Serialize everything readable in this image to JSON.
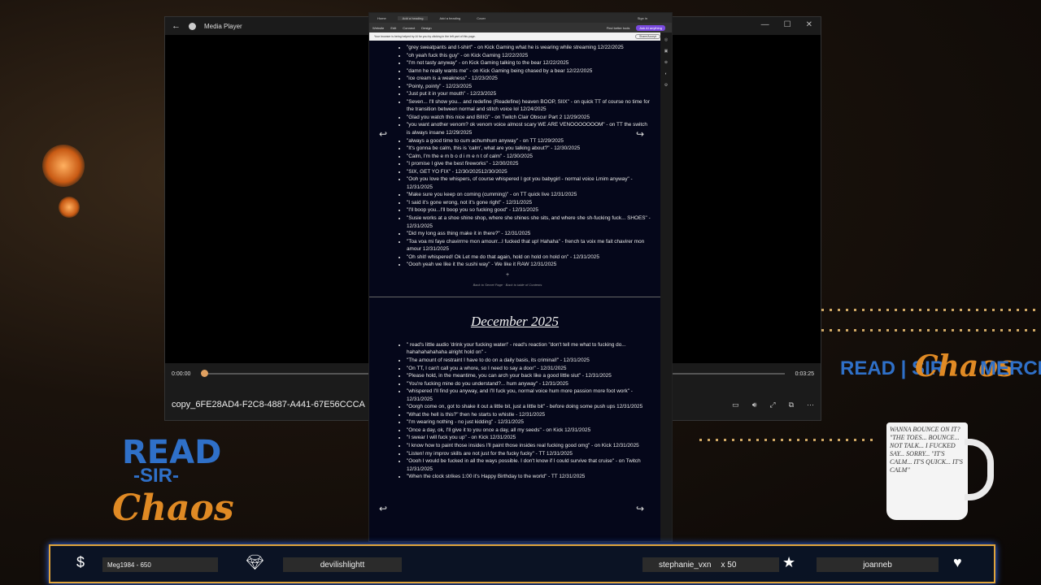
{
  "media_player": {
    "title": "Media Player",
    "back_icon": "back-arrow-icon",
    "time_current": "0:00:00",
    "time_total": "0:03:25",
    "progress": 0.0,
    "filename": "copy_6FE28AD4-F2C8-4887-A441-67E56CCCA"
  },
  "browser": {
    "tabs": [
      "Home",
      "Add a heading",
      "Add a heading",
      "Cover"
    ],
    "sign_in": "Sign in",
    "toolbar": [
      "Website",
      "Edit",
      "Connect",
      "Design",
      "Find better tools",
      "Ask AI anything"
    ],
    "url_hint": "Your browser is being helped by AI for you by clicking in the left part of this page.",
    "share_label": "Share/Accept",
    "quotes_top": [
      "\"grey sweatpants and t-shirt\" - on Kick Gaming what he is wearing while streaming 12/22/2025",
      "\"oh yeah fuck this guy\" - on Kick Gaming 12/22/2025",
      "\"I'm not tasty anyway\" - on Kick Gaming talking to the bear 12/22/2025",
      "\"damn he really wants me\" - on Kick Gaming being chased by a bear 12/22/2025",
      "\"ice cream is a weakness\" - 12/23/2025",
      "\"Pointy, pointy\" - 12/23/2025",
      "\"Just put it in your mouth\" - 12/23/2025",
      "\"Seven... I'll show you... and redefine (Readefine) heaven BOOP, SIIX\" - on quick TT of course no time for the transition between normal and stitch voice lol 12/24/2025",
      "\"Glad you watch this nice and BIIIG\" - on Twitch Clair Obscur Part 2 12/29/2025",
      "\"you want another venom? ok venom voice almost scary WE ARE VENOOOOOOOM\" - on TT the switch is always insane 12/29/2025",
      "\"always a good time to cum achumhum anyway\" - on TT 12/29/2025",
      "\"It's gonna be calm, this is 'calm', what are you talking about?\" - 12/30/2025",
      "\"Calm, I'm the e m b o d i m e n t of calm\" - 12/30/2025",
      "\"I promise I give the best fireworks\" - 12/30/2025",
      "\"SIX, GET YO FIX\" - 12/30/202512/30/2025",
      "\"Ooh you love the whispers, of course whispered I got you babygirl - normal voice Lmim anyway\" - 12/31/2025",
      "\"Make sure you keep on coming (cumming)\" - on TT quick live 12/31/2025",
      "\"I said it's gone wrong, not it's gone right\" - 12/31/2025",
      "\"I'll boop you...I'll boop you so fucking good\" - 12/31/2025",
      "\"Susie works at a shoe shine shop, where she shines she sits, and where she sh-fucking fuck... SHOES\" - 12/31/2025",
      "\"Did my long ass thing make it in there?\" - 12/31/2025",
      "\"Toa voa mi faye chavirrrre mon amourr...I fucked that up! Hahaha\" - french ta voix me fait chavirer mon amour 12/31/2025",
      "\"Oh shit! whispered! Ok Let me do that again, hold on hold on hold on\" - 12/31/2025",
      "\"Oooh yeah we like it the sushi way\" - We like it RAW 12/31/2025"
    ],
    "nav_links": "Back to Secret Page · Back to table of Contents",
    "plus": "+",
    "month_heading": "December 2025",
    "quotes_bottom": [
      "\" read's little audio 'drink your fucking water!' - read's reaction \"don't tell me what to fucking do... hahahahahahaha alright hold on\" -",
      "\"The amount of restraint I have to do on a daily basis, its criminal!\" - 12/31/2025",
      "\"On TT, I can't call you a whore, so I need to say a door\" - 12/31/2025",
      "\"Please hold, in the meantime, you can arch your back like a good little slut\" - 12/31/2025",
      "\"You're fucking mine do you understand?... hum anyway\" - 12/31/2025",
      "\"whispered I'll find you anyway, and I'll fuck you, normal voice hum more passion more foot work\" - 12/31/2025",
      "\"Oorgh come on, got to shake it out a little bit, just a little bit\" - before doing some push ups 12/31/2025",
      "\"What the hell is this?\" then he starts to whistle - 12/31/2025",
      "\"I'm wearing nothing - no just kidding\" - 12/31/2025",
      "\"Once a day, ok, I'll give it to you once a day, all my seeds\" - on Kick 12/31/2025",
      "\"I swear I will fuck you up\" - on Kick 12/31/2025",
      "\"I know how to paint those insides I'll paint those insides real fucking good omg\" - on Kick 12/31/2025",
      "\"Listen! my improv skills are not just for the fucky fucky\" - TT 12/31/2025",
      "\"Oooh I would be fucked in all the ways possible. I don't know if I could survive that cruise\" - on Twitch 12/31/2025",
      "\"When the clock strikes 1:00 it's Happy Birthday to the world\" - TT 12/31/2025"
    ]
  },
  "overlay": {
    "logo": {
      "read": "READ",
      "sir": "-SIR-",
      "chaos": "Chaos"
    },
    "merch": {
      "read": "READ | SIR",
      "chaos": "Chaos",
      "merch": "MERCH"
    },
    "mug_text": "WANNA BOUNCE ON IT? \"THE TOES... BOUNCE... NOT TALK... I FUCKED SAY... SORRY... \"IT'S CALM... IT'S QUICK... IT'S CALM\""
  },
  "stream_bar": {
    "tip_label": "Meg1984 - 650",
    "sub_label": "devilishlightt",
    "gift_label": "stephanie_vxn",
    "gift_count": "x 50",
    "follow_label": "joanneb"
  },
  "colors": {
    "accent_gold": "#e0a43a",
    "brand_blue": "#2f70c8",
    "brand_orange": "#e08a24"
  }
}
